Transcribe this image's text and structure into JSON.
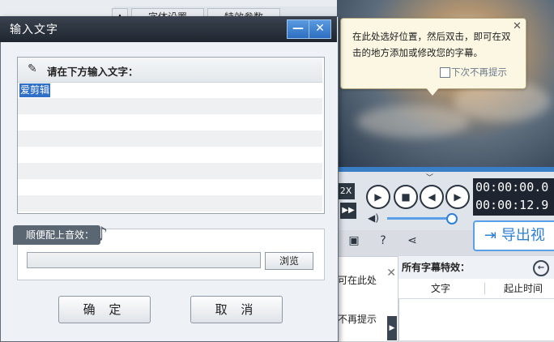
{
  "background": {
    "tabs": [
      "字体设置",
      "特效参数"
    ],
    "tooltip": {
      "text": "在此处选好位置，然后双击，即可在双击的地方添加或修改您的字幕。",
      "dont_show": "下次不再提示"
    },
    "player": {
      "speed": "2X",
      "time_current": "00:00:00.0",
      "time_total": "00:00:12.9",
      "volume": 0.95
    },
    "export_label": "导出视",
    "left_panel": {
      "partial_text": "可在此处",
      "partial_dont_show": "不再提示"
    },
    "effects_panel": {
      "title": "所有字幕特效：",
      "col_text": "文字",
      "col_start": "起止时间"
    }
  },
  "dialog": {
    "title": "输入文字",
    "input_label": "请在下方输入文字：",
    "typed_text": "爱剪辑",
    "sound_label": "顺便配上音效：",
    "sound_path": "",
    "browse_label": "浏览",
    "ok_label": "确 定",
    "cancel_label": "取 消"
  }
}
